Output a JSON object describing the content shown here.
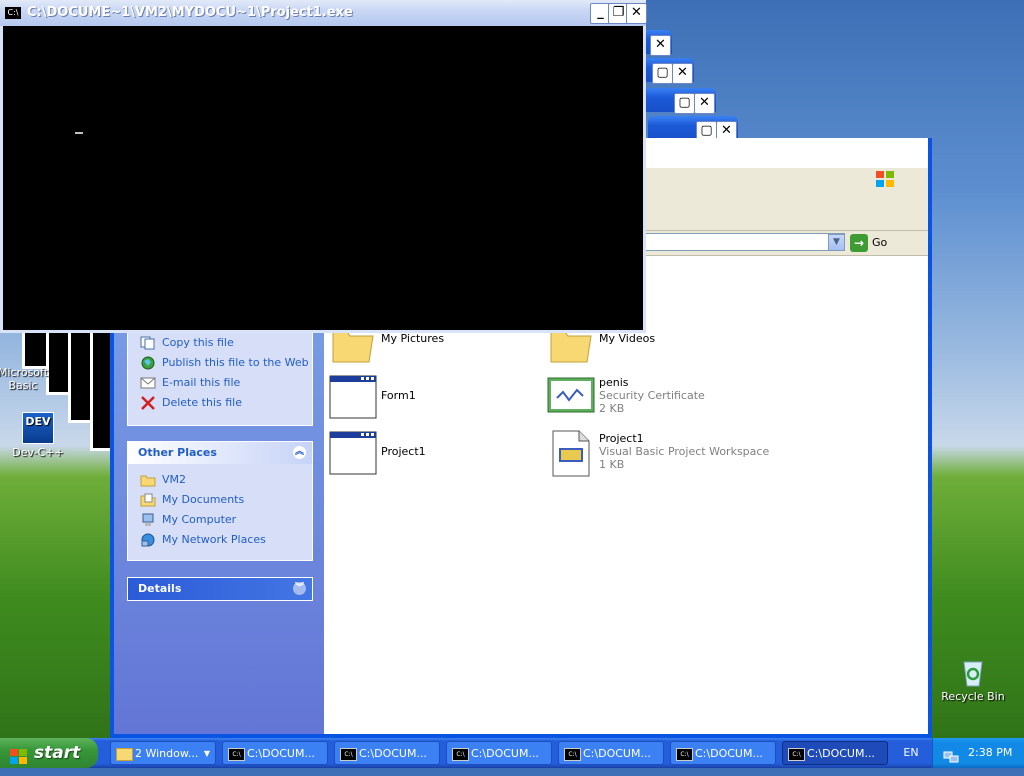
{
  "desktop": {
    "icons": [
      {
        "label": "Microsoft Basic"
      },
      {
        "label": "Dev-C++"
      },
      {
        "label": "Recycle Bin"
      }
    ]
  },
  "console": {
    "title": "C:\\DOCUME~1\\VM2\\MYDOCU~1\\Project1.exe",
    "icon_text": "C:\\"
  },
  "explorer": {
    "go_label": "Go",
    "file_tasks": [
      {
        "label": "Copy this file",
        "icon": "copy-icon"
      },
      {
        "label": "Publish this file to the Web",
        "icon": "globe-icon"
      },
      {
        "label": "E-mail this file",
        "icon": "email-icon"
      },
      {
        "label": "Delete this file",
        "icon": "delete-icon"
      }
    ],
    "other_places": {
      "title": "Other Places",
      "items": [
        {
          "label": "VM2",
          "icon": "folder-icon"
        },
        {
          "label": "My Documents",
          "icon": "documents-icon"
        },
        {
          "label": "My Computer",
          "icon": "computer-icon"
        },
        {
          "label": "My Network Places",
          "icon": "network-icon"
        }
      ]
    },
    "details": {
      "title": "Details"
    },
    "files": [
      {
        "name": "My Pictures",
        "type": "",
        "size": ""
      },
      {
        "name": "My Videos",
        "type": "",
        "size": ""
      },
      {
        "name": "Form1",
        "type": "",
        "size": ""
      },
      {
        "name": "penis",
        "type": "Security Certificate",
        "size": "2 KB"
      },
      {
        "name": "Project1",
        "type": "",
        "size": ""
      },
      {
        "name": "Project1",
        "type": "Visual Basic Project Workspace",
        "size": "1 KB"
      }
    ]
  },
  "taskbar": {
    "start_label": "start",
    "tasks": [
      {
        "label": "2 Window..."
      },
      {
        "label": "C:\\DOCUM..."
      },
      {
        "label": "C:\\DOCUM..."
      },
      {
        "label": "C:\\DOCUM..."
      },
      {
        "label": "C:\\DOCUM..."
      },
      {
        "label": "C:\\DOCUM..."
      },
      {
        "label": "C:\\DOCUM..."
      }
    ],
    "language": "EN",
    "clock": "2:38 PM"
  }
}
